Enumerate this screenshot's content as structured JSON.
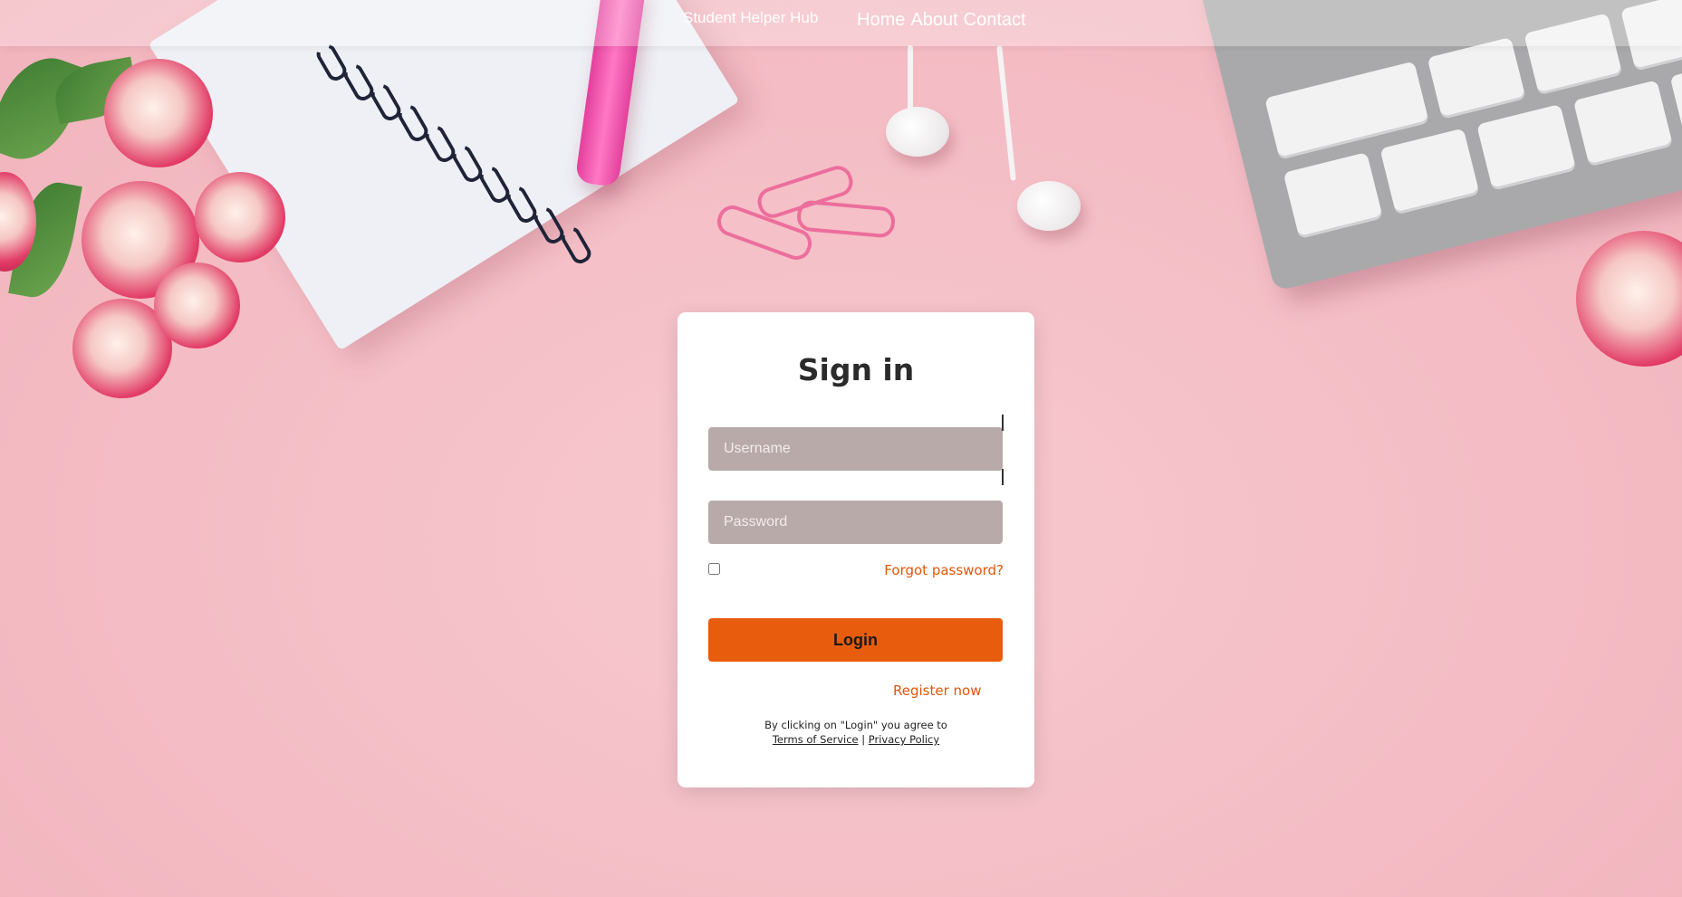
{
  "nav": {
    "brand": "Student Helper Hub",
    "links": [
      "Home",
      "About",
      "Contact"
    ]
  },
  "form": {
    "title": "Sign in",
    "username_placeholder": "Username",
    "password_placeholder": "Password",
    "forgot_label": "Forgot password?",
    "login_label": "Login",
    "register_label": "Register now",
    "terms_prefix": "By clicking on \"Login\" you agree to",
    "terms_link": "Terms of Service",
    "separator": "|",
    "privacy_link": "Privacy Policy"
  },
  "colors": {
    "accent": "#e85c0d",
    "input_bg": "#b9aaaa",
    "page_bg": "#f5c2c9"
  }
}
